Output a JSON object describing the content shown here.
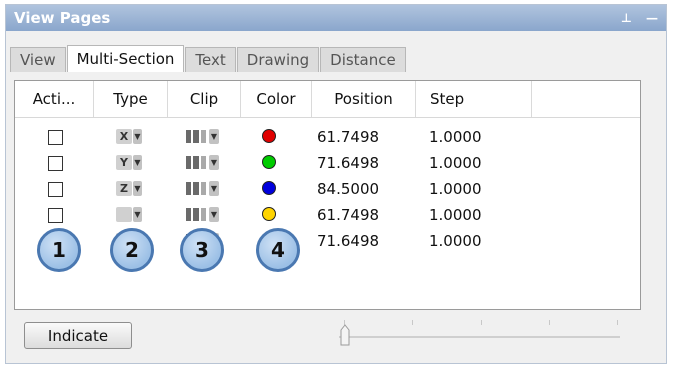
{
  "window": {
    "title": "View Pages",
    "pin_icon": "pin-icon",
    "minimize_icon": "minimize-icon"
  },
  "tabs": [
    {
      "label": "View",
      "active": false
    },
    {
      "label": "Multi-Section",
      "active": true
    },
    {
      "label": "Text",
      "active": false
    },
    {
      "label": "Drawing",
      "active": false
    },
    {
      "label": "Distance",
      "active": false
    }
  ],
  "columns": {
    "active": "Acti...",
    "type": "Type",
    "clip": "Clip",
    "color": "Color",
    "position": "Position",
    "step": "Step"
  },
  "rows": [
    {
      "type": "X",
      "color": "#e00000",
      "position": "61.7498",
      "step": "1.0000"
    },
    {
      "type": "Y",
      "color": "#00cc00",
      "position": "71.6498",
      "step": "1.0000"
    },
    {
      "type": "Z",
      "color": "#0000dd",
      "position": "84.5000",
      "step": "1.0000"
    },
    {
      "type": "",
      "color": "#ffd400",
      "position": "61.7498",
      "step": "1.0000"
    },
    {
      "type": "",
      "color": "#f07800",
      "position": "71.6498",
      "step": "1.0000"
    }
  ],
  "badges": [
    "1",
    "2",
    "3",
    "4"
  ],
  "buttons": {
    "indicate": "Indicate"
  }
}
